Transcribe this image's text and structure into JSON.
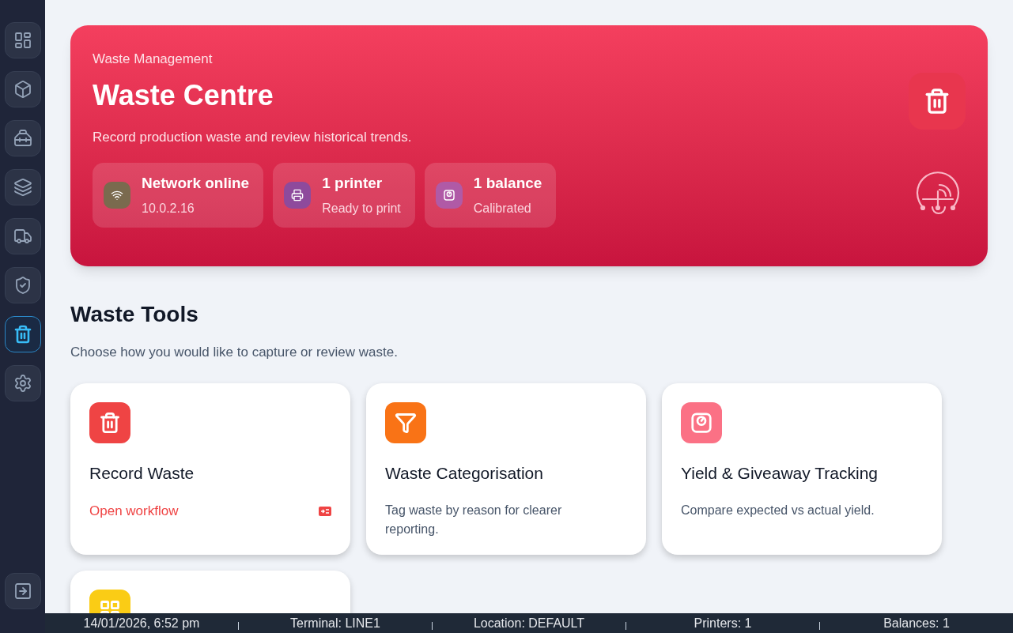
{
  "sidebar": {
    "items": [
      {
        "kind": "dashboard",
        "selected": false
      },
      {
        "kind": "box",
        "selected": false
      },
      {
        "kind": "toolbox",
        "selected": false
      },
      {
        "kind": "layers",
        "selected": false
      },
      {
        "kind": "truck",
        "selected": false
      },
      {
        "kind": "shield",
        "selected": false
      },
      {
        "kind": "waste",
        "selected": true
      },
      {
        "kind": "settings",
        "selected": false
      }
    ],
    "footer": {
      "kind": "logout"
    }
  },
  "hero": {
    "eyebrow": "Waste Management",
    "title": "Waste Centre",
    "subtitle": "Record production waste and review historical trends.",
    "status": [
      {
        "kind": "network",
        "title": "Network online",
        "detail": "10.0.2.16",
        "color": "#7a6a4e"
      },
      {
        "kind": "printer",
        "title": "1 printer",
        "detail": "Ready to print",
        "color": "#8e4a9c"
      },
      {
        "kind": "balance",
        "title": "1 balance",
        "detail": "Calibrated",
        "color": "#b05aa6"
      }
    ]
  },
  "section": {
    "title": "Waste Tools",
    "subtitle": "Choose how you would like to capture or review waste."
  },
  "tools": [
    {
      "kind": "link",
      "color": "#ef4444",
      "title": "Record Waste",
      "text": "Open workflow"
    },
    {
      "kind": "description",
      "color": "#f97316",
      "title": "Waste Categorisation",
      "text": "Tag waste by reason for clearer reporting."
    },
    {
      "kind": "description",
      "color": "#fb7185",
      "title": "Yield & Giveaway Tracking",
      "text": "Compare expected vs actual yield."
    },
    {
      "kind": "hidden",
      "color": "#facc15"
    }
  ],
  "status_bar": [
    "14/01/2026, 6:52 pm",
    "Terminal: LINE1",
    "Location: DEFAULT",
    "Printers: 1",
    "Balances: 1"
  ]
}
